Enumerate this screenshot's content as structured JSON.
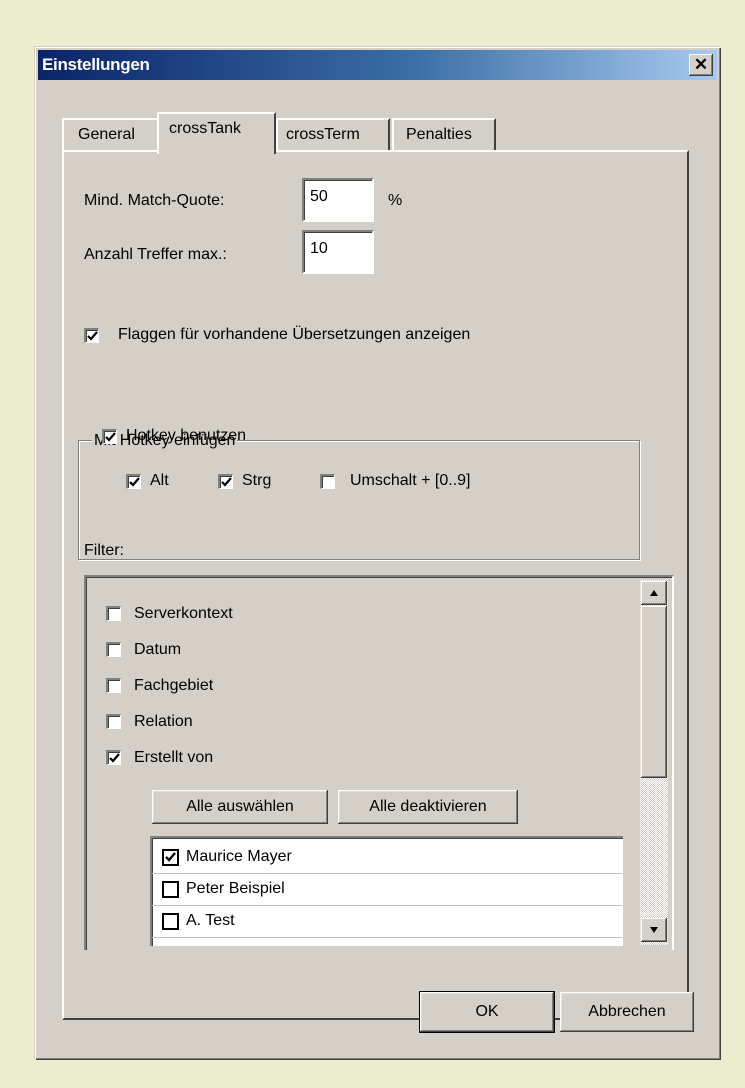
{
  "window": {
    "title": "Einstellungen",
    "close_glyph": "✕"
  },
  "tabs": [
    {
      "label": "General",
      "active": false
    },
    {
      "label": "crossTank",
      "active": true
    },
    {
      "label": "crossTerm",
      "active": false
    },
    {
      "label": "Penalties",
      "active": false
    }
  ],
  "match": {
    "label": "Mind.  Match-Quote:",
    "value": "50",
    "unit": "%"
  },
  "hits": {
    "label": "Anzahl Treffer max.:",
    "value": "10"
  },
  "flags": {
    "label": "Flaggen für vorhandene Übersetzungen anzeigen",
    "checked": true
  },
  "hotkey_group": {
    "title": "Mit Hotkey einfügen",
    "use_hotkey": {
      "label": "Hotkey benutzen",
      "checked": true
    },
    "alt": {
      "label": "Alt",
      "checked": true
    },
    "strg": {
      "label": "Strg",
      "checked": true
    },
    "shift": {
      "label": "Umschalt + [0..9]",
      "checked": false
    }
  },
  "filter": {
    "label": "Filter:",
    "items": [
      {
        "label": "Serverkontext",
        "checked": false
      },
      {
        "label": "Datum",
        "checked": false
      },
      {
        "label": "Fachgebiet",
        "checked": false
      },
      {
        "label": "Relation",
        "checked": false
      },
      {
        "label": "Erstellt von",
        "checked": true
      }
    ],
    "select_all": "Alle auswählen",
    "deselect_all": "Alle deaktivieren",
    "users": [
      {
        "name": "Maurice Mayer",
        "checked": true
      },
      {
        "name": "Peter Beispiel",
        "checked": false
      },
      {
        "name": "A. Test",
        "checked": false
      }
    ]
  },
  "footer": {
    "ok": "OK",
    "cancel": "Abbrechen"
  }
}
